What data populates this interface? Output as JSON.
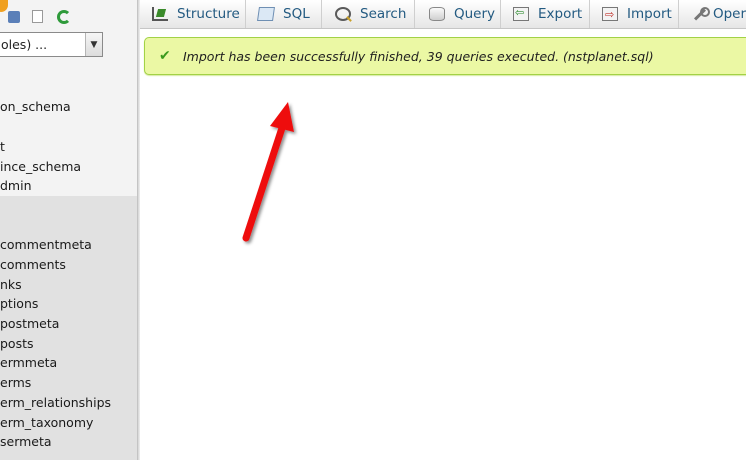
{
  "sidebar": {
    "db_select": {
      "value": "oles) ..."
    },
    "top_items": [
      "on_schema",
      "t",
      "ince_schema",
      "dmin"
    ],
    "tables": [
      "commentmeta",
      "comments",
      "nks",
      "ptions",
      "postmeta",
      "posts",
      "ermmeta",
      "erms",
      "erm_relationships",
      "erm_taxonomy",
      "sermeta"
    ]
  },
  "tabs": [
    {
      "label": "Structure",
      "icon": "structure-icon"
    },
    {
      "label": "SQL",
      "icon": "sql-icon"
    },
    {
      "label": "Search",
      "icon": "search-icon"
    },
    {
      "label": "Query",
      "icon": "query-icon"
    },
    {
      "label": "Export",
      "icon": "export-icon"
    },
    {
      "label": "Import",
      "icon": "import-icon"
    },
    {
      "label": "Oper",
      "icon": "operations-icon"
    }
  ],
  "message": {
    "text": "Import has been successfully finished, 39 queries executed. (nstplanet.sql)",
    "icon": "check-icon"
  },
  "colors": {
    "tab_text": "#235a81",
    "success_bg": "#ebf8a4",
    "success_border": "#a2d246",
    "arrow": "#ee1111"
  }
}
